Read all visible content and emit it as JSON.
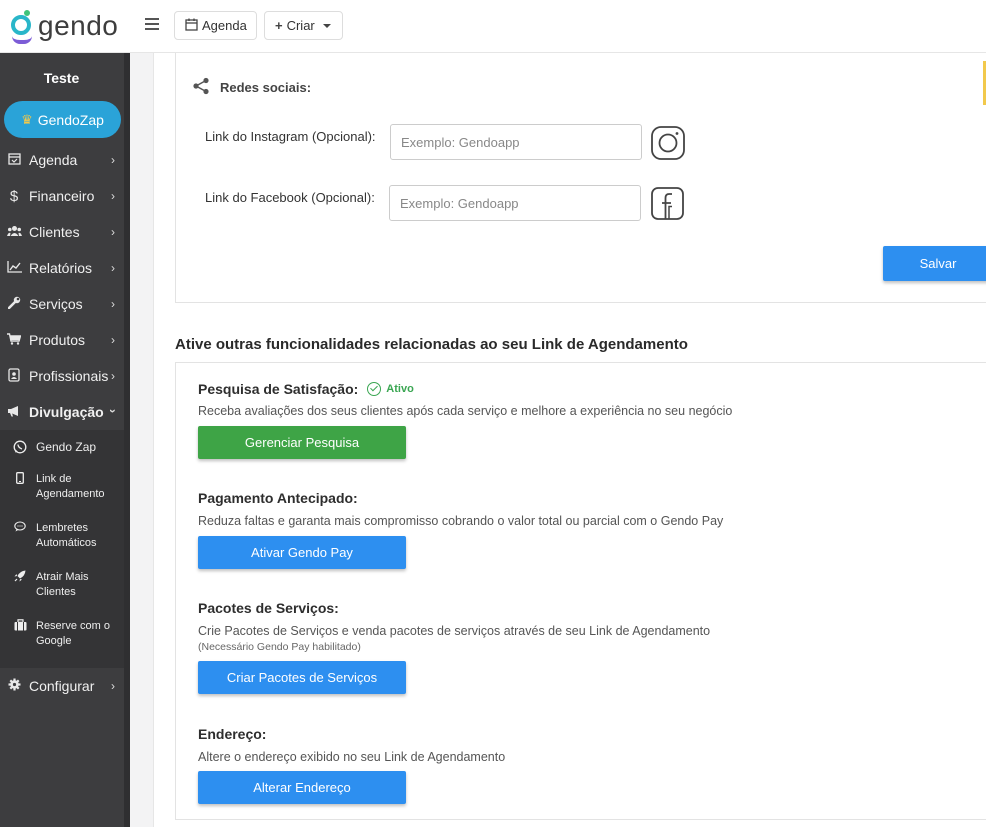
{
  "header": {
    "logo_text": "gendo",
    "agenda_button": "Agenda",
    "criar_button": "Criar"
  },
  "sidebar": {
    "user_name": "Teste",
    "zap_button": "GendoZap",
    "items": [
      {
        "label": "Agenda",
        "icon": "calendar-icon"
      },
      {
        "label": "Financeiro",
        "icon": "dollar-icon"
      },
      {
        "label": "Clientes",
        "icon": "users-icon"
      },
      {
        "label": "Relatórios",
        "icon": "chart-line-icon"
      },
      {
        "label": "Serviços",
        "icon": "wrench-icon"
      },
      {
        "label": "Produtos",
        "icon": "cart-icon"
      },
      {
        "label": "Profissionais",
        "icon": "id-badge-icon"
      },
      {
        "label": "Divulgação",
        "icon": "megaphone-icon"
      },
      {
        "label": "Configurar",
        "icon": "gear-icon"
      }
    ],
    "submenu": [
      {
        "label": "Gendo Zap",
        "icon": "whatsapp-icon"
      },
      {
        "label": "Link de Agendamento",
        "icon": "mobile-icon"
      },
      {
        "label": "Lembretes Automáticos",
        "icon": "chat-icon"
      },
      {
        "label": "Atrair Mais Clientes",
        "icon": "rocket-icon"
      },
      {
        "label": "Reserve com o Google",
        "icon": "briefcase-icon"
      }
    ]
  },
  "social": {
    "heading": "Redes sociais:",
    "instagram_label": "Link do Instagram (Opcional):",
    "instagram_placeholder": "Exemplo: Gendoapp",
    "facebook_label": "Link do Facebook (Opcional):",
    "facebook_placeholder": "Exemplo: Gendoapp",
    "save_button": "Salvar"
  },
  "features": {
    "heading": "Ative outras funcionalidades relacionadas ao seu Link de Agendamento",
    "items": [
      {
        "title": "Pesquisa de Satisfação:",
        "status": "Ativo",
        "description": "Receba avaliações dos seus clientes após cada serviço e melhore a experiência no seu negócio",
        "button": "Gerenciar Pesquisa",
        "button_color": "#3ea446"
      },
      {
        "title": "Pagamento Antecipado:",
        "description": "Reduza faltas e garanta mais compromisso cobrando o valor total ou parcial com o Gendo Pay",
        "button": "Ativar Gendo Pay",
        "button_color": "#2d8ff0"
      },
      {
        "title": "Pacotes de Serviços:",
        "description": "Crie Pacotes de Serviços e venda pacotes de serviços através de seu Link de Agendamento",
        "note": "(Necessário Gendo Pay habilitado)",
        "button": "Criar Pacotes de Serviços",
        "button_color": "#2d8ff0"
      },
      {
        "title": "Endereço:",
        "description": "Altere o endereço exibido no seu Link de Agendamento",
        "button": "Alterar Endereço",
        "button_color": "#2d8ff0"
      }
    ]
  }
}
